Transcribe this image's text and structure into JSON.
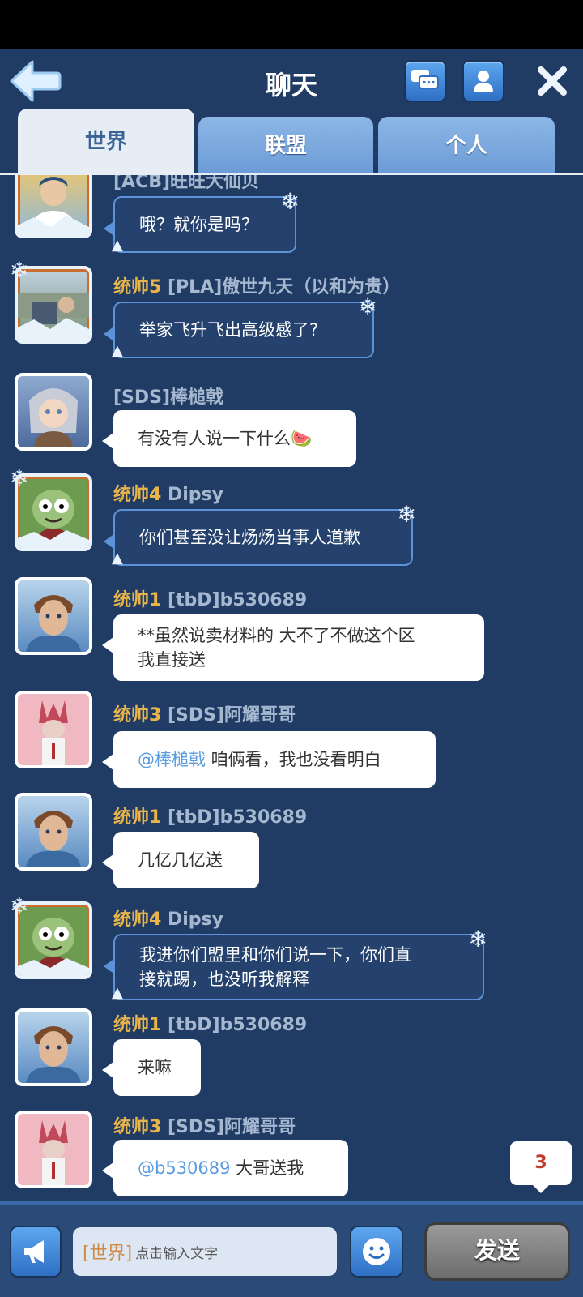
{
  "header": {
    "title": "聊天"
  },
  "tabs": [
    {
      "label": "世界",
      "active": true
    },
    {
      "label": "联盟",
      "active": false
    },
    {
      "label": "个人",
      "active": false
    }
  ],
  "messages": [
    {
      "rank": "",
      "name": "[ACB]旺旺大仙贝",
      "text": "哦？就你是吗？",
      "bubble": "winter"
    },
    {
      "rank": "统帅5",
      "name": " [PLA]傲世九天（以和为贵）",
      "text": "举家飞升飞出高级感了?",
      "bubble": "winter"
    },
    {
      "rank": "",
      "name": "[SDS]棒槌戟",
      "text": "有没有人说一下什么🍉",
      "bubble": "white"
    },
    {
      "rank": "统帅4",
      "name": " Dipsy",
      "text": "你们甚至没让炀炀当事人道歉",
      "bubble": "winter"
    },
    {
      "rank": "统帅1",
      "name": " [tbD]b530689",
      "text": "**虽然说卖材料的 大不了不做这个区",
      "text2": "我直接送",
      "bubble": "white"
    },
    {
      "rank": "统帅3",
      "name": " [SDS]阿耀哥哥",
      "mention": "@棒槌戟",
      "text": " 咱俩看，我也没看明白",
      "bubble": "white"
    },
    {
      "rank": "统帅1",
      "name": " [tbD]b530689",
      "text": "几亿几亿送",
      "bubble": "white"
    },
    {
      "rank": "统帅4",
      "name": " Dipsy",
      "text": "我进你们盟里和你们说一下，你们直",
      "text2": "接就踢，也没听我解释",
      "bubble": "winter"
    },
    {
      "rank": "统帅1",
      "name": " [tbD]b530689",
      "text": "来嘛",
      "bubble": "white"
    },
    {
      "rank": "统帅3",
      "name": " [SDS]阿耀哥哥",
      "mention": "@b530689",
      "text": " 大哥送我",
      "bubble": "white"
    }
  ],
  "input": {
    "channel_tag": "[世界]",
    "placeholder": "点击输入文字"
  },
  "send_label": "发送",
  "unread_count": "3",
  "colors": {
    "background": "#203c64",
    "accent": "#e9b54a",
    "mention": "#5a9de0"
  }
}
